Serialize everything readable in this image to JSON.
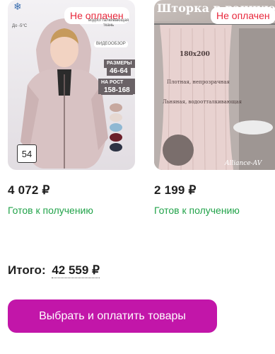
{
  "products": [
    {
      "badge": "Не оплачен",
      "price": "4 072 ₽",
      "status": "Готов к получению",
      "image": {
        "temp_label": "До -5°C",
        "feature_label": "водоотталкивающая ткань",
        "video_label": "ВИДЕООБЗОР",
        "sizes_title": "РАЗМЕРЫ",
        "sizes_value": "46-64",
        "height_title": "НА РОСТ (см)",
        "height_value": "158-168",
        "count": "54"
      }
    },
    {
      "badge": "Не оплачен",
      "price": "2 199 ₽",
      "status": "Готов к получению",
      "image": {
        "title": "Шторка в ванную",
        "size": "180х200",
        "text1": "Плотная, непрозрачная",
        "text2": "Льняная, водоотталкивающая",
        "brand": "Alliance-AV"
      }
    }
  ],
  "total": {
    "label": "Итого:",
    "value": "42 559 ₽"
  },
  "pay_button": {
    "label": "Выбрать и оплатить товары"
  },
  "colors": {
    "accent": "#c216a9",
    "status_green": "#22a34a",
    "badge_red": "#e8283c"
  }
}
